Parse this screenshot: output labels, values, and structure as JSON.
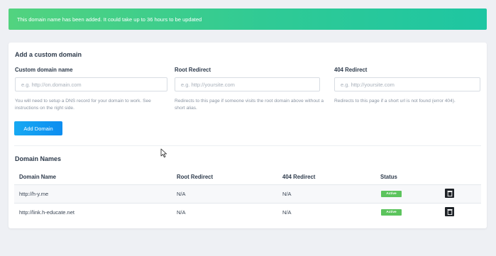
{
  "alert": {
    "message": "This domain name has been added. It could take up to 36 hours to be updated"
  },
  "add_domain": {
    "title": "Add a custom domain",
    "custom_domain": {
      "label": "Custom domain name",
      "placeholder": "e.g. http://on.domain.com",
      "value": "",
      "help": "You will need to setup a DNS record for your domain to work. See instructions on the right side."
    },
    "root_redirect": {
      "label": "Root Redirect",
      "placeholder": "e.g. http://yoursite.com",
      "value": "",
      "help": "Redirects to this page if someone visits the root domain above without a short alias."
    },
    "redirect_404": {
      "label": "404 Redirect",
      "placeholder": "e.g. http://yoursite.com",
      "value": "",
      "help": "Redirects to this page if a short url is not found (error 404)."
    },
    "button_label": "Add Domain"
  },
  "domain_names": {
    "title": "Domain Names",
    "columns": [
      "Domain Name",
      "Root Redirect",
      "404 Redirect",
      "Status"
    ],
    "rows": [
      {
        "domain": "http://h-y.me",
        "root_redirect": "N/A",
        "redirect_404": "N/A",
        "status": "Active"
      },
      {
        "domain": "http://link.h-educate.net",
        "root_redirect": "N/A",
        "redirect_404": "N/A",
        "status": "Active"
      }
    ]
  },
  "colors": {
    "alert_gradient_start": "#52d37f",
    "alert_gradient_end": "#1ec6a2",
    "primary_button": "#0d8df0",
    "status_active": "#5cc45d",
    "delete_button": "#1f2328"
  },
  "icons": {
    "delete": "trash-icon",
    "cursor": "mouse-pointer-icon"
  }
}
